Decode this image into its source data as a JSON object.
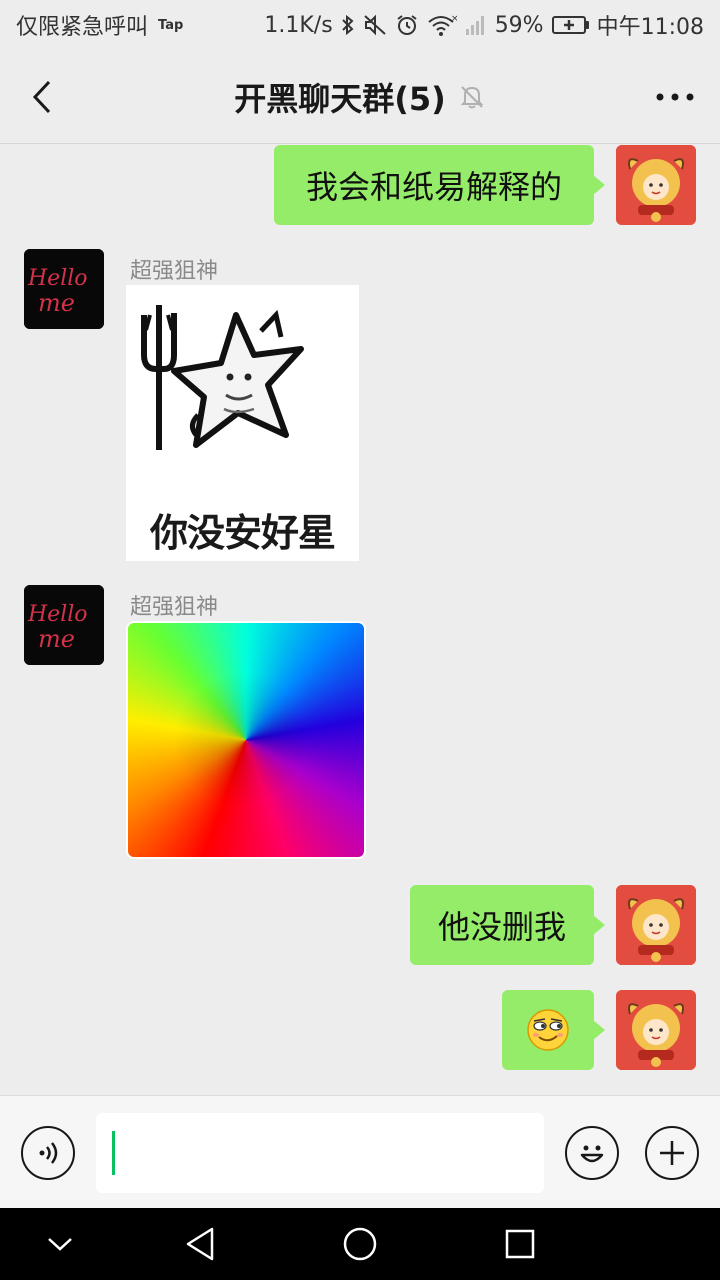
{
  "status_bar": {
    "carrier_text": "仅限紧急呼叫",
    "tap_badge": "Tap",
    "network_speed": "1.1K/s",
    "battery_percent": "59%",
    "time": "中午11:08",
    "icons": [
      "bluetooth-icon",
      "mute-icon",
      "alarm-icon",
      "wifi-icon",
      "signal-icon",
      "battery-icon"
    ]
  },
  "header": {
    "title": "开黑聊天群(5)",
    "icons": [
      "back-icon",
      "mute-bell-icon",
      "more-icon"
    ]
  },
  "messages": [
    {
      "side": "right",
      "type": "text",
      "text": "我会和纸易解释的"
    },
    {
      "side": "left",
      "type": "sticker",
      "sender": "超强狙神",
      "caption": "你没安好星"
    },
    {
      "side": "left",
      "type": "image",
      "sender": "超强狙神",
      "image_desc": "rainbow-swirl"
    },
    {
      "side": "right",
      "type": "text",
      "text": "他没删我"
    },
    {
      "side": "right",
      "type": "emoji",
      "emoji": "😏"
    }
  ],
  "avatars": {
    "other_text": "Hello me"
  },
  "input_bar": {
    "value": "",
    "icons": [
      "voice-icon",
      "emoji-icon",
      "plus-icon"
    ]
  },
  "nav_bar": {
    "icons": [
      "nav-down-icon",
      "nav-back-icon",
      "nav-home-icon",
      "nav-recents-icon"
    ]
  },
  "colors": {
    "bubble_green": "#95ec69",
    "background": "#ededed",
    "caret": "#07c160"
  }
}
